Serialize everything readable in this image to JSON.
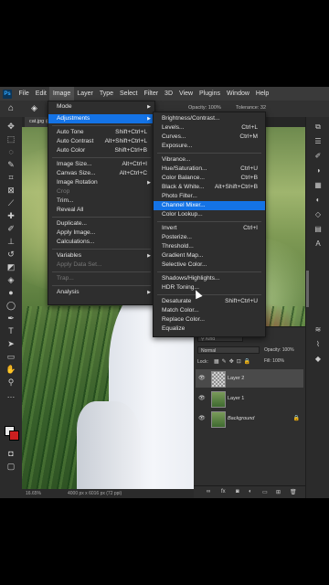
{
  "menubar": {
    "items": [
      "File",
      "Edit",
      "Image",
      "Layer",
      "Type",
      "Select",
      "Filter",
      "3D",
      "View",
      "Plugins",
      "Window",
      "Help"
    ],
    "active": "Image"
  },
  "options": {
    "opacity_label": "Opacity: 100%",
    "tolerance_label": "Tolerance: 32"
  },
  "document": {
    "tab_label": "cat.jpg @",
    "zoom": "16.65%",
    "doc_info": "4000 px x 6016 px (72 ppi)"
  },
  "image_menu": {
    "items": [
      {
        "label": "Mode",
        "arrow": true
      },
      {
        "label": "Adjustments",
        "arrow": true,
        "highlighted": true
      },
      {
        "label": "Auto Tone",
        "shortcut": "Shift+Ctrl+L"
      },
      {
        "label": "Auto Contrast",
        "shortcut": "Alt+Shift+Ctrl+L"
      },
      {
        "label": "Auto Color",
        "shortcut": "Shift+Ctrl+B"
      },
      {
        "label": "Image Size...",
        "shortcut": "Alt+Ctrl+I"
      },
      {
        "label": "Canvas Size...",
        "shortcut": "Alt+Ctrl+C"
      },
      {
        "label": "Image Rotation",
        "arrow": true
      },
      {
        "label": "Crop",
        "disabled": true
      },
      {
        "label": "Trim..."
      },
      {
        "label": "Reveal All"
      },
      {
        "label": "Duplicate..."
      },
      {
        "label": "Apply Image..."
      },
      {
        "label": "Calculations..."
      },
      {
        "label": "Variables",
        "arrow": true
      },
      {
        "label": "Apply Data Set...",
        "disabled": true
      },
      {
        "label": "Trap...",
        "disabled": true
      },
      {
        "label": "Analysis",
        "arrow": true
      }
    ]
  },
  "adjustments_menu": {
    "items": [
      {
        "label": "Brightness/Contrast..."
      },
      {
        "label": "Levels...",
        "shortcut": "Ctrl+L"
      },
      {
        "label": "Curves...",
        "shortcut": "Ctrl+M"
      },
      {
        "label": "Exposure..."
      },
      {
        "label": "Vibrance..."
      },
      {
        "label": "Hue/Saturation...",
        "shortcut": "Ctrl+U"
      },
      {
        "label": "Color Balance...",
        "shortcut": "Ctrl+B"
      },
      {
        "label": "Black & White...",
        "shortcut": "Alt+Shift+Ctrl+B"
      },
      {
        "label": "Photo Filter..."
      },
      {
        "label": "Channel Mixer...",
        "highlighted": true
      },
      {
        "label": "Color Lookup..."
      },
      {
        "label": "Invert",
        "shortcut": "Ctrl+I"
      },
      {
        "label": "Posterize..."
      },
      {
        "label": "Threshold..."
      },
      {
        "label": "Gradient Map..."
      },
      {
        "label": "Selective Color..."
      },
      {
        "label": "Shadows/Highlights..."
      },
      {
        "label": "HDR Toning..."
      },
      {
        "label": "Desaturate",
        "shortcut": "Shift+Ctrl+U"
      },
      {
        "label": "Match Color..."
      },
      {
        "label": "Replace Color..."
      },
      {
        "label": "Equalize"
      }
    ]
  },
  "layers_panel": {
    "filter_label": "Kind",
    "blend_mode": "Normal",
    "opacity": "Opacity: 100%",
    "lock_label": "Lock:",
    "fill": "Fill: 100%",
    "layers": [
      {
        "name": "Layer 2",
        "selected": true
      },
      {
        "name": "Layer 1",
        "selected": false
      },
      {
        "name": "Background",
        "selected": false,
        "locked": true
      }
    ],
    "footer_fx": "fx"
  },
  "colors": {
    "accent": "#1473e6",
    "menu_bg": "#2e2e2e",
    "app_bg": "#2b2b2b",
    "fg_swatch": "#e8e8e8",
    "bg_swatch": "#cc1f1f"
  }
}
